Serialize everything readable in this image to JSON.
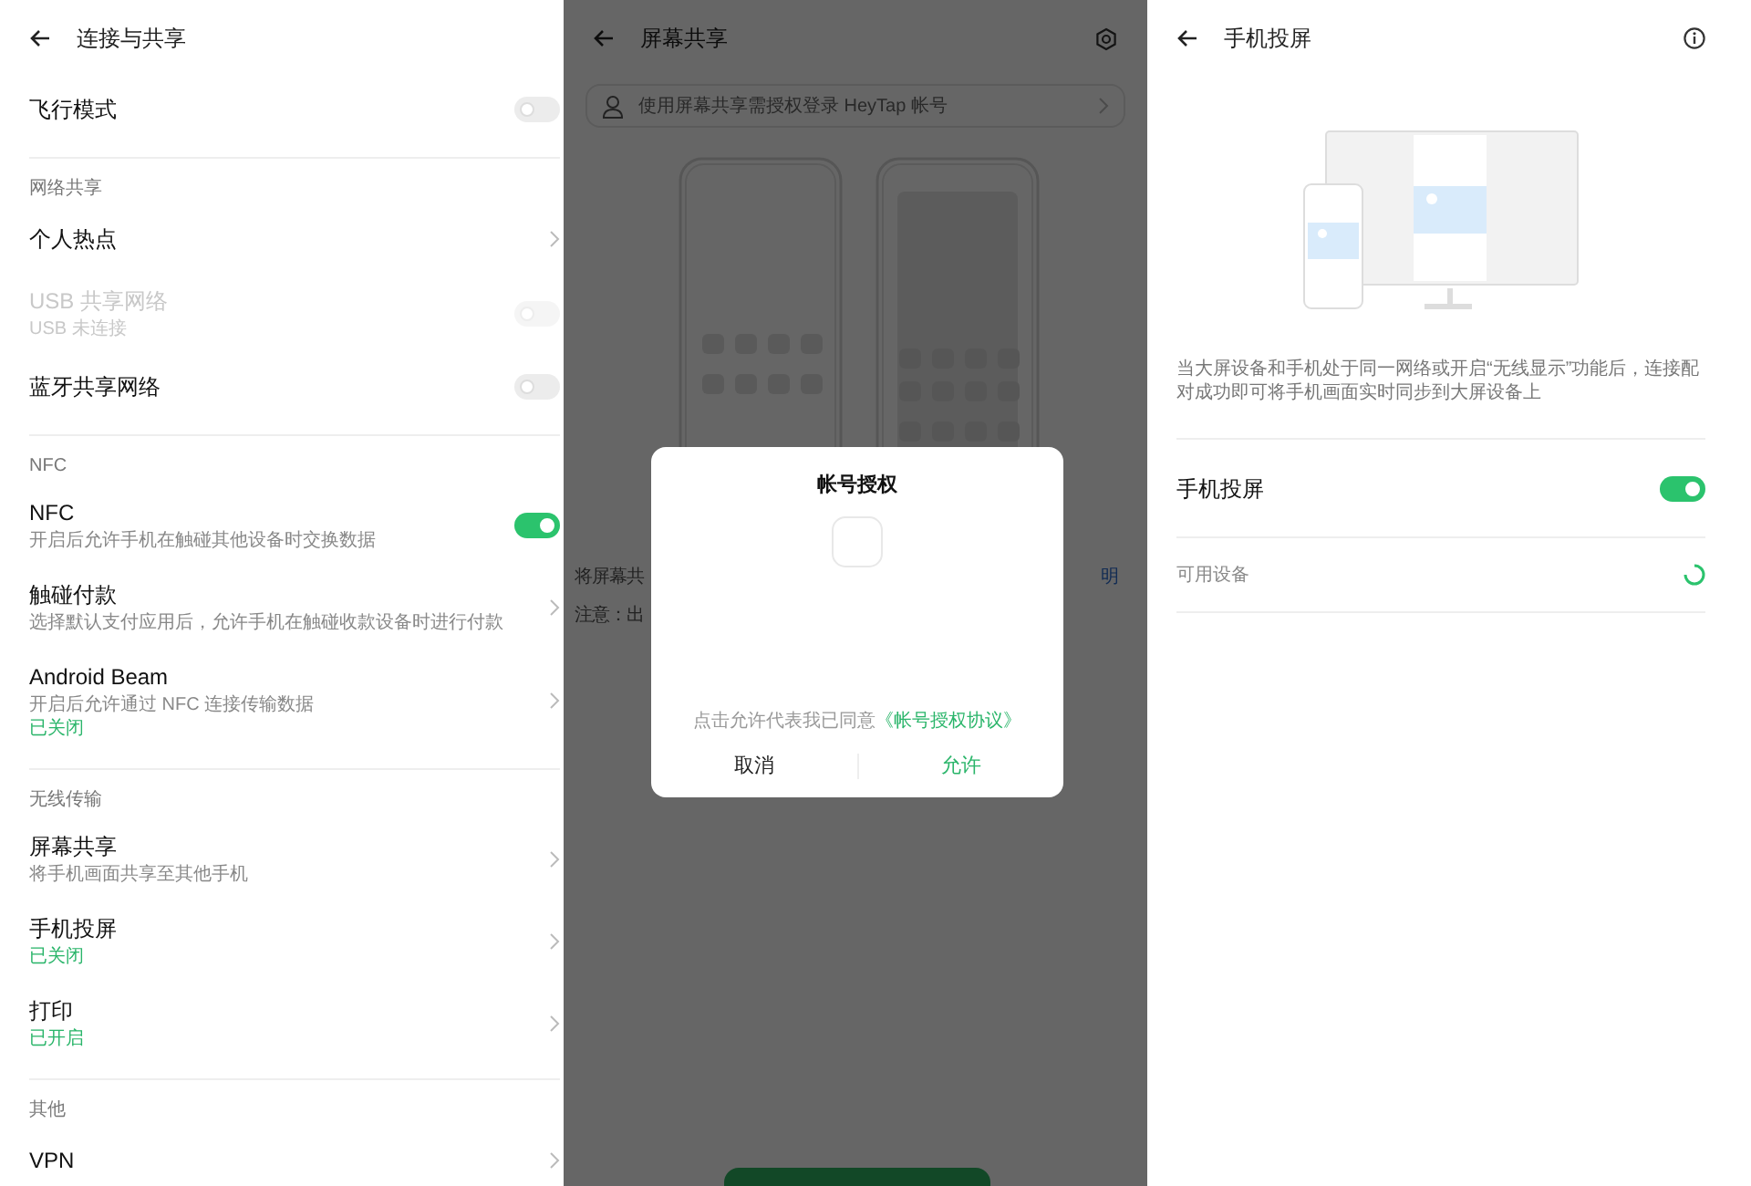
{
  "connection_settings": {
    "title": "连接与共享",
    "sections": [
      {
        "rows": [
          {
            "kind": "toggle",
            "label": "飞行模式",
            "on": false,
            "disabled": false
          }
        ]
      },
      {
        "header": "网络共享",
        "rows": [
          {
            "kind": "link",
            "label": "个人热点",
            "disabled": false
          },
          {
            "kind": "toggle",
            "label": "USB 共享网络",
            "subtitle": "USB 未连接",
            "on": false,
            "disabled": true
          },
          {
            "kind": "toggle",
            "label": "蓝牙共享网络",
            "on": false,
            "disabled": false
          }
        ]
      },
      {
        "header": "NFC",
        "rows": [
          {
            "kind": "toggle",
            "label": "NFC",
            "subtitle": "开启后允许手机在触碰其他设备时交换数据",
            "on": true,
            "disabled": false
          },
          {
            "kind": "link",
            "label": "触碰付款",
            "subtitle": "选择默认支付应用后，允许手机在触碰收款设备时进行付款",
            "disabled": false
          },
          {
            "kind": "link",
            "label": "Android Beam",
            "subtitle": "开启后允许通过 NFC 连接传输数据",
            "status": "已关闭",
            "disabled": false
          }
        ]
      },
      {
        "header": "无线传输",
        "rows": [
          {
            "kind": "link",
            "label": "屏幕共享",
            "subtitle": "将手机画面共享至其他手机",
            "disabled": false
          },
          {
            "kind": "link",
            "label": "手机投屏",
            "status": "已关闭",
            "disabled": false
          },
          {
            "kind": "link",
            "label": "打印",
            "status": "已开启",
            "disabled": false
          }
        ]
      },
      {
        "header": "其他",
        "rows": [
          {
            "kind": "link",
            "label": "VPN",
            "disabled": false
          }
        ]
      }
    ]
  },
  "screen_share": {
    "title": "屏幕共享",
    "account_banner": "使用屏幕共享需授权登录 HeyTap 帐号",
    "info_start": "将屏幕共",
    "info_link_end": "明",
    "note_start": "注意：出",
    "dialog": {
      "title": "帐号授权",
      "agreement": "点击允许代表我已同意",
      "agreement_link": "《帐号授权协议》",
      "buttons": [
        {
          "label": "取消",
          "kind": "cancel"
        },
        {
          "label": "允许",
          "kind": "confirm"
        }
      ]
    }
  },
  "screen_cast": {
    "title": "手机投屏",
    "description": "当大屏设备和手机处于同一网络或开启“无线显示”功能后，连接配对成功即可将手机画面实时同步到大屏设备上",
    "cast_toggle": {
      "label": "手机投屏",
      "on": true
    },
    "devices_label": "可用设备"
  }
}
